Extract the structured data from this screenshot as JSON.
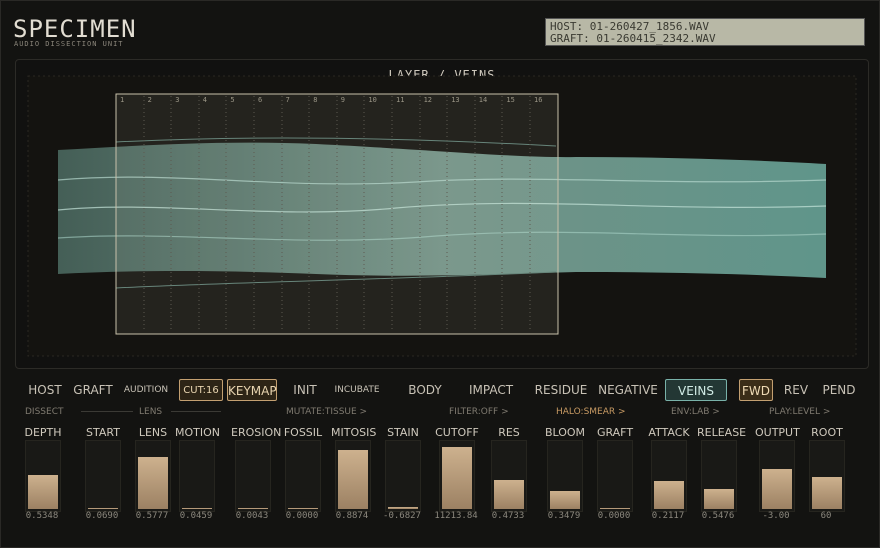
{
  "app": {
    "title": "SPECIMEN",
    "subtitle": "AUDIO DISSECTION UNIT"
  },
  "display": {
    "host_line": "HOST:  01-260427_1856.WAV",
    "graft_line": "GRAFT: 01-260415_2342.WAV"
  },
  "viewer": {
    "title": "LAYER / VEINS",
    "slices": [
      "1",
      "2",
      "3",
      "4",
      "5",
      "6",
      "7",
      "8",
      "9",
      "10",
      "11",
      "12",
      "13",
      "14",
      "15",
      "16"
    ]
  },
  "modes": {
    "host": "HOST",
    "graft": "GRAFT",
    "audition": "AUDITION",
    "cut": "CUT:16",
    "keymap": "KEYMAP",
    "init": "INIT",
    "incubate": "INCUBATE",
    "body": "BODY",
    "impact": "IMPACT",
    "residue": "RESIDUE",
    "negative": "NEGATIVE",
    "veins": "VEINS",
    "fwd": "FWD",
    "rev": "REV",
    "pend": "PEND"
  },
  "sections": {
    "dissect": "DISSECT",
    "lens": "LENS",
    "mutate": "MUTATE:TISSUE >",
    "filter": "FILTER:OFF >",
    "halo": "HALO:SMEAR >",
    "env": "ENV:LAB >",
    "play": "PLAY:LEVEL >"
  },
  "params": [
    {
      "label": "DEPTH",
      "value": "0.5348",
      "level": 0.53
    },
    {
      "label": "START",
      "value": "0.0690",
      "level": 0.0
    },
    {
      "label": "LENS",
      "value": "0.5777",
      "level": 0.82
    },
    {
      "label": "MOTION",
      "value": "0.0459",
      "level": 0.0
    },
    {
      "label": "EROSION",
      "value": "0.0043",
      "level": 0.0
    },
    {
      "label": "FOSSIL",
      "value": "0.0000",
      "level": 0.0
    },
    {
      "label": "MITOSIS",
      "value": "0.8874",
      "level": 0.92
    },
    {
      "label": "STAIN",
      "value": "-0.6827",
      "level": 0.03
    },
    {
      "label": "CUTOFF",
      "value": "11213.84",
      "level": 0.97
    },
    {
      "label": "RES",
      "value": "0.4733",
      "level": 0.45
    },
    {
      "label": "BLOOM",
      "value": "0.3479",
      "level": 0.28
    },
    {
      "label": "GRAFT",
      "value": "0.0000",
      "level": 0.0
    },
    {
      "label": "ATTACK",
      "value": "0.2117",
      "level": 0.44
    },
    {
      "label": "RELEASE",
      "value": "0.5476",
      "level": 0.31
    },
    {
      "label": "OUTPUT",
      "value": "-3.00",
      "level": 0.62
    },
    {
      "label": "ROOT",
      "value": "60",
      "level": 0.5
    }
  ]
}
